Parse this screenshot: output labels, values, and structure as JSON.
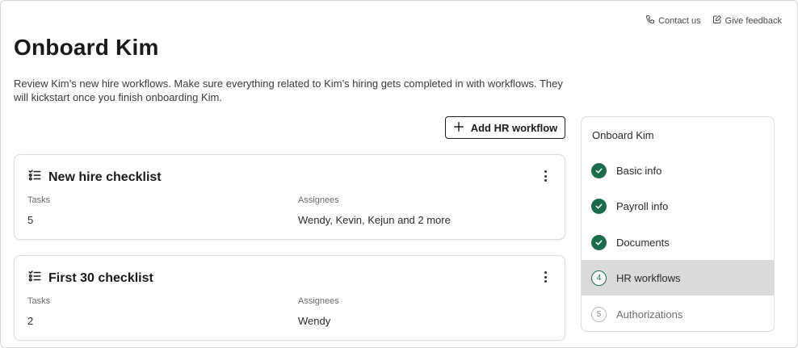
{
  "header": {
    "contact_label": "Contact us",
    "feedback_label": "Give feedback",
    "title": "Onboard Kim",
    "description": "Review Kim’s new hire workflows. Make sure everything related to Kim’s hiring gets completed in with workflows. They will kickstart once you finish onboarding Kim."
  },
  "actions": {
    "add_workflow_label": "Add HR workflow"
  },
  "workflows": [
    {
      "title": "New hire checklist",
      "tasks_label": "Tasks",
      "tasks_value": "5",
      "assignees_label": "Assignees",
      "assignees_value": "Wendy, Kevin, Kejun and 2 more"
    },
    {
      "title": "First 30 checklist",
      "tasks_label": "Tasks",
      "tasks_value": "2",
      "assignees_label": "Assignees",
      "assignees_value": "Wendy"
    }
  ],
  "stepper": {
    "title": "Onboard Kim",
    "steps": [
      {
        "number": "1",
        "label": "Basic info",
        "status": "done"
      },
      {
        "number": "2",
        "label": "Payroll info",
        "status": "done"
      },
      {
        "number": "3",
        "label": "Documents",
        "status": "done"
      },
      {
        "number": "4",
        "label": "HR workflows",
        "status": "current"
      },
      {
        "number": "5",
        "label": "Authorizations",
        "status": "todo"
      }
    ]
  },
  "colors": {
    "accent_green": "#1b6b4a",
    "active_step_bg": "#dadada"
  },
  "icons": {
    "contact": "phone-icon",
    "feedback": "feedback-icon",
    "add": "plus-icon",
    "checklist": "checklist-icon",
    "menu": "more-vertical-icon",
    "done": "check-icon"
  }
}
